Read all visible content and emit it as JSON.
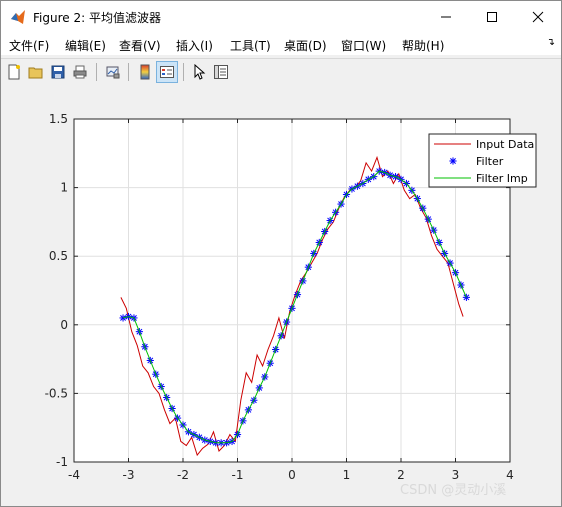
{
  "window": {
    "title": "Figure 2: 平均值滤波器"
  },
  "menu": [
    "文件(F)",
    "编辑(E)",
    "查看(V)",
    "插入(I)",
    "工具(T)",
    "桌面(D)",
    "窗口(W)",
    "帮助(H)"
  ],
  "toolbar": [
    "new-figure",
    "open-file",
    "save",
    "print",
    "link-plot",
    "insert-colorbar",
    "insert-legend",
    "edit-plot",
    "property-inspector"
  ],
  "watermark": "CSDN @灵动小溪",
  "chart_data": {
    "type": "line",
    "title": "",
    "xlabel": "",
    "ylabel": "",
    "xlim": [
      -4,
      4
    ],
    "ylim": [
      -1,
      1.5
    ],
    "xticks": [
      "-4",
      "-3",
      "-2",
      "-1",
      "0",
      "1",
      "2",
      "3",
      "4"
    ],
    "yticks": [
      "-1",
      "-0.5",
      "0",
      "0.5",
      "1",
      "1.5"
    ],
    "grid": true,
    "legend": "top-right",
    "series": [
      {
        "name": "Input Data",
        "color": "#cc0000",
        "style": "line",
        "x": [
          -3.14,
          -3.04,
          -2.94,
          -2.84,
          -2.74,
          -2.64,
          -2.54,
          -2.44,
          -2.34,
          -2.24,
          -2.14,
          -2.04,
          -1.94,
          -1.84,
          -1.74,
          -1.64,
          -1.54,
          -1.44,
          -1.34,
          -1.24,
          -1.14,
          -1.04,
          -0.94,
          -0.84,
          -0.74,
          -0.64,
          -0.54,
          -0.44,
          -0.34,
          -0.24,
          -0.14,
          -0.04,
          0.06,
          0.16,
          0.26,
          0.36,
          0.46,
          0.56,
          0.66,
          0.76,
          0.86,
          0.96,
          1.06,
          1.16,
          1.26,
          1.36,
          1.46,
          1.56,
          1.66,
          1.76,
          1.86,
          1.96,
          2.06,
          2.16,
          2.26,
          2.36,
          2.46,
          2.56,
          2.66,
          2.76,
          2.86,
          2.96,
          3.06,
          3.14
        ],
        "y": [
          0.2,
          0.12,
          -0.05,
          -0.15,
          -0.3,
          -0.35,
          -0.45,
          -0.5,
          -0.62,
          -0.72,
          -0.68,
          -0.85,
          -0.88,
          -0.82,
          -0.95,
          -0.9,
          -0.87,
          -0.78,
          -0.92,
          -0.88,
          -0.8,
          -0.85,
          -0.55,
          -0.35,
          -0.42,
          -0.22,
          -0.3,
          -0.18,
          -0.08,
          0.05,
          -0.1,
          0.1,
          0.22,
          0.32,
          0.38,
          0.45,
          0.52,
          0.62,
          0.7,
          0.75,
          0.85,
          0.93,
          0.98,
          1.0,
          1.05,
          1.18,
          1.12,
          1.22,
          1.08,
          1.12,
          1.03,
          1.1,
          0.98,
          0.92,
          0.95,
          0.85,
          0.78,
          0.65,
          0.55,
          0.5,
          0.45,
          0.3,
          0.15,
          0.06
        ]
      },
      {
        "name": "Filter",
        "color": "#0000ff",
        "style": "markers",
        "x": [
          -3.1,
          -3.0,
          -2.9,
          -2.8,
          -2.7,
          -2.6,
          -2.5,
          -2.4,
          -2.3,
          -2.2,
          -2.1,
          -2.0,
          -1.9,
          -1.8,
          -1.7,
          -1.6,
          -1.5,
          -1.4,
          -1.3,
          -1.2,
          -1.1,
          -1.0,
          -0.9,
          -0.8,
          -0.7,
          -0.6,
          -0.5,
          -0.4,
          -0.3,
          -0.2,
          -0.1,
          0.0,
          0.1,
          0.2,
          0.3,
          0.4,
          0.5,
          0.6,
          0.7,
          0.8,
          0.9,
          1.0,
          1.1,
          1.2,
          1.3,
          1.4,
          1.5,
          1.6,
          1.7,
          1.8,
          1.9,
          2.0,
          2.1,
          2.2,
          2.3,
          2.4,
          2.5,
          2.6,
          2.7,
          2.8,
          2.9,
          3.0,
          3.1,
          3.2
        ],
        "y": [
          0.05,
          0.06,
          0.05,
          -0.05,
          -0.16,
          -0.26,
          -0.36,
          -0.45,
          -0.53,
          -0.61,
          -0.68,
          -0.73,
          -0.78,
          -0.8,
          -0.82,
          -0.84,
          -0.85,
          -0.86,
          -0.86,
          -0.86,
          -0.85,
          -0.8,
          -0.7,
          -0.62,
          -0.55,
          -0.46,
          -0.38,
          -0.28,
          -0.18,
          -0.08,
          0.02,
          0.12,
          0.22,
          0.32,
          0.42,
          0.52,
          0.6,
          0.68,
          0.76,
          0.82,
          0.88,
          0.95,
          0.99,
          1.01,
          1.03,
          1.06,
          1.08,
          1.12,
          1.11,
          1.09,
          1.08,
          1.06,
          1.03,
          0.98,
          0.92,
          0.85,
          0.77,
          0.69,
          0.6,
          0.52,
          0.45,
          0.38,
          0.29,
          0.2
        ]
      },
      {
        "name": "Filter Imp",
        "color": "#00c000",
        "style": "line",
        "x": [
          -3.1,
          -3.0,
          -2.9,
          -2.8,
          -2.7,
          -2.6,
          -2.5,
          -2.4,
          -2.3,
          -2.2,
          -2.1,
          -2.0,
          -1.9,
          -1.8,
          -1.7,
          -1.6,
          -1.5,
          -1.4,
          -1.3,
          -1.2,
          -1.1,
          -1.0,
          -0.9,
          -0.8,
          -0.7,
          -0.6,
          -0.5,
          -0.4,
          -0.3,
          -0.2,
          -0.1,
          0.0,
          0.1,
          0.2,
          0.3,
          0.4,
          0.5,
          0.6,
          0.7,
          0.8,
          0.9,
          1.0,
          1.1,
          1.2,
          1.3,
          1.4,
          1.5,
          1.6,
          1.7,
          1.8,
          1.9,
          2.0,
          2.1,
          2.2,
          2.3,
          2.4,
          2.5,
          2.6,
          2.7,
          2.8,
          2.9,
          3.0,
          3.1,
          3.2
        ],
        "y": [
          0.05,
          0.06,
          0.05,
          -0.05,
          -0.16,
          -0.26,
          -0.36,
          -0.45,
          -0.53,
          -0.61,
          -0.68,
          -0.73,
          -0.78,
          -0.8,
          -0.82,
          -0.84,
          -0.85,
          -0.86,
          -0.86,
          -0.86,
          -0.85,
          -0.8,
          -0.7,
          -0.62,
          -0.55,
          -0.46,
          -0.38,
          -0.28,
          -0.18,
          -0.08,
          0.02,
          0.12,
          0.22,
          0.32,
          0.42,
          0.52,
          0.6,
          0.68,
          0.76,
          0.82,
          0.88,
          0.95,
          0.99,
          1.01,
          1.03,
          1.06,
          1.08,
          1.12,
          1.11,
          1.09,
          1.08,
          1.06,
          1.03,
          0.98,
          0.92,
          0.85,
          0.77,
          0.69,
          0.6,
          0.52,
          0.45,
          0.38,
          0.29,
          0.2
        ]
      }
    ]
  }
}
